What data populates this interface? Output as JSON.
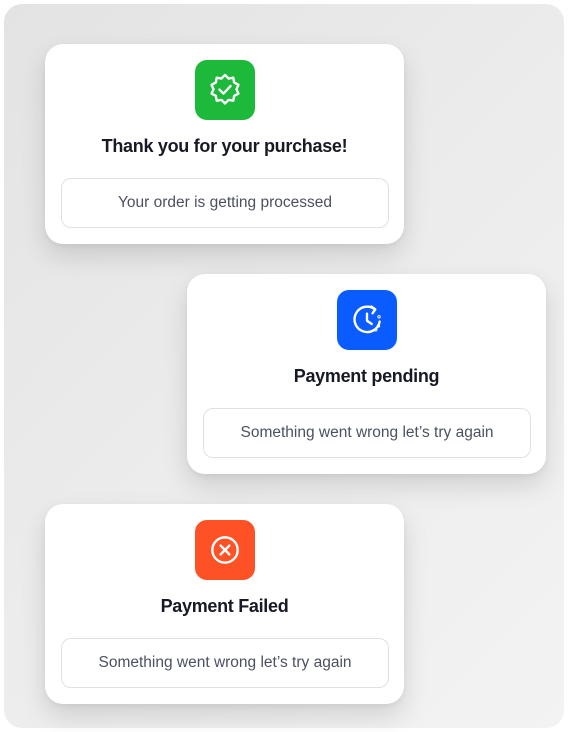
{
  "colors": {
    "success": "#1CB93A",
    "pending": "#0B5CFF",
    "failed": "#FF5126",
    "title_text": "#171A26",
    "message_text": "#4B5162",
    "message_border": "#DFE1E6"
  },
  "cards": [
    {
      "status": "success",
      "icon": "verified-badge-check-icon",
      "title": "Thank you for your purchase!",
      "message": "Your order is getting processed"
    },
    {
      "status": "pending",
      "icon": "clock-pending-icon",
      "title": "Payment pending",
      "message": "Something went wrong let’s try again"
    },
    {
      "status": "failed",
      "icon": "x-circle-icon",
      "title": "Payment Failed",
      "message": "Something went wrong let’s try again"
    }
  ]
}
